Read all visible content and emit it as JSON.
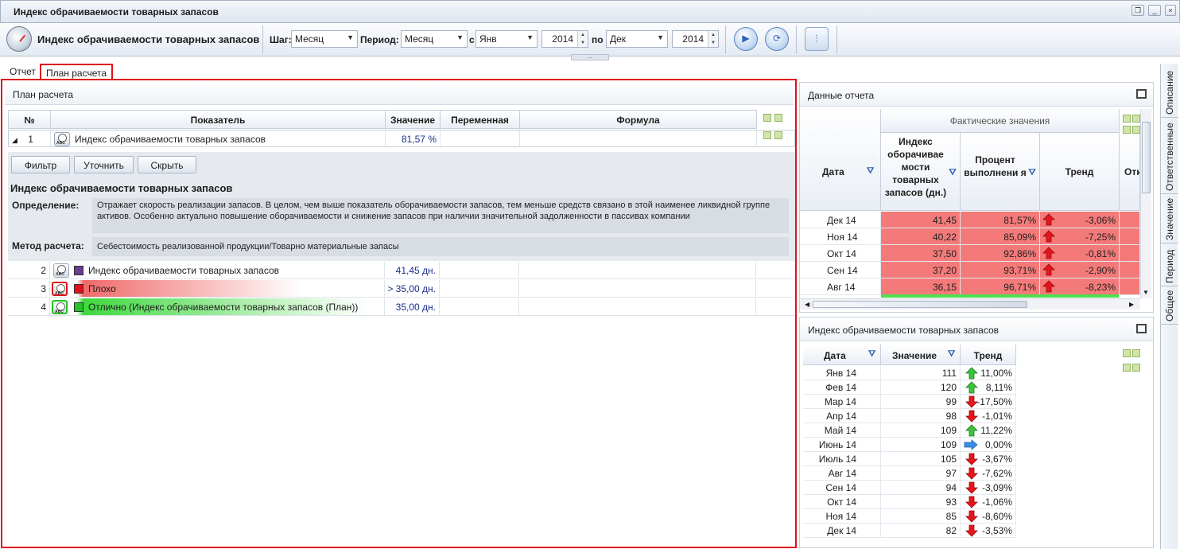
{
  "window": {
    "title": "Индекс обрачиваемости товарных запасов"
  },
  "toolbar": {
    "app_title": "Индекс обрачиваемости товарных запасов",
    "step_label": "Шаг:",
    "step_value": "Месяц",
    "period_label": "Период:",
    "period_value": "Месяц",
    "from_label": "с",
    "from_month": "Янв",
    "from_year": "2014",
    "to_label": "по",
    "to_month": "Дек",
    "to_year": "2014"
  },
  "tabs": [
    {
      "label": "Отчет"
    },
    {
      "label": "План расчета"
    }
  ],
  "plan": {
    "title": "План расчета",
    "columns": {
      "num": "№",
      "indicator": "Показатель",
      "value": "Значение",
      "variable": "Переменная",
      "formula": "Формула"
    },
    "row1": {
      "num": "1",
      "name": "Индекс обрачиваемости товарных запасов",
      "value": "81,57 %"
    },
    "buttons": {
      "filter": "Фильтр",
      "refine": "Уточнить",
      "hide": "Скрыть"
    },
    "detail": {
      "title": "Индекс обрачиваемости товарных запасов",
      "definition_label": "Определение:",
      "definition": "Отражает скорость реализации запасов. В целом, чем выше показатель оборачиваемости запасов, тем меньше средств связано в этой наименее ликвидной группе активов. Особенно актуально повышение оборачиваемости и снижение запасов при наличии значительной задолженности в пассивах компании",
      "method_label": "Метод расчета:",
      "method": "Себестоимость реализованной продукции/Товарно материальные запасы"
    },
    "rows": [
      {
        "num": "2",
        "name": "Индекс обрачиваемости товарных запасов",
        "value": "41,45 дн.",
        "color": "#6a3d8f"
      },
      {
        "num": "3",
        "name": "Плохо",
        "value": "> 35,00 дн.",
        "color": "#e0101a"
      },
      {
        "num": "4",
        "name": "Отлично (Индекс обрачиваемости товарных запасов (План))",
        "value": "35,00 дн.",
        "color": "#22c322"
      }
    ]
  },
  "report": {
    "title": "Данные отчета",
    "group_header": "Фактические значения",
    "columns": {
      "date": "Дата",
      "index": "Индекс оборачивае мости товарных запасов (дн.)",
      "percent": "Процент выполнени я",
      "trend": "Тренд",
      "extra": "Отк"
    },
    "rows": [
      {
        "date": "Дек 14",
        "index": "41,45",
        "percent": "81,57%",
        "trend": "-3,06%"
      },
      {
        "date": "Ноя 14",
        "index": "40,22",
        "percent": "85,09%",
        "trend": "-7,25%"
      },
      {
        "date": "Окт 14",
        "index": "37,50",
        "percent": "92,86%",
        "trend": "-0,81%"
      },
      {
        "date": "Сен 14",
        "index": "37,20",
        "percent": "93,71%",
        "trend": "-2,90%"
      },
      {
        "date": "Авг 14",
        "index": "36,15",
        "percent": "96,71%",
        "trend": "-8,23%"
      }
    ]
  },
  "index_panel": {
    "title": "Индекс обрачиваемости товарных запасов",
    "columns": {
      "date": "Дата",
      "value": "Значение",
      "trend": "Тренд"
    },
    "rows": [
      {
        "date": "Янв 14",
        "value": "111",
        "trend": "11,00%",
        "dir": "up"
      },
      {
        "date": "Фев 14",
        "value": "120",
        "trend": "8,11%",
        "dir": "up"
      },
      {
        "date": "Мар 14",
        "value": "99",
        "trend": "-17,50%",
        "dir": "down"
      },
      {
        "date": "Апр 14",
        "value": "98",
        "trend": "-1,01%",
        "dir": "down"
      },
      {
        "date": "Май 14",
        "value": "109",
        "trend": "11,22%",
        "dir": "up"
      },
      {
        "date": "Июнь 14",
        "value": "109",
        "trend": "0,00%",
        "dir": "flat"
      },
      {
        "date": "Июль 14",
        "value": "105",
        "trend": "-3,67%",
        "dir": "down"
      },
      {
        "date": "Авг 14",
        "value": "97",
        "trend": "-7,62%",
        "dir": "down"
      },
      {
        "date": "Сен 14",
        "value": "94",
        "trend": "-3,09%",
        "dir": "down"
      },
      {
        "date": "Окт 14",
        "value": "93",
        "trend": "-1,06%",
        "dir": "down"
      },
      {
        "date": "Ноя 14",
        "value": "85",
        "trend": "-8,60%",
        "dir": "down"
      },
      {
        "date": "Дек 14",
        "value": "82",
        "trend": "-3,53%",
        "dir": "down"
      }
    ]
  },
  "side_tabs": [
    {
      "label": "Описание"
    },
    {
      "label": "Ответственные"
    },
    {
      "label": "Значение"
    },
    {
      "label": "Период"
    },
    {
      "label": "Общее"
    }
  ],
  "colors": {
    "bad": "#f47a7a",
    "good": "#4ce04c",
    "highlight": "#e0101a"
  }
}
